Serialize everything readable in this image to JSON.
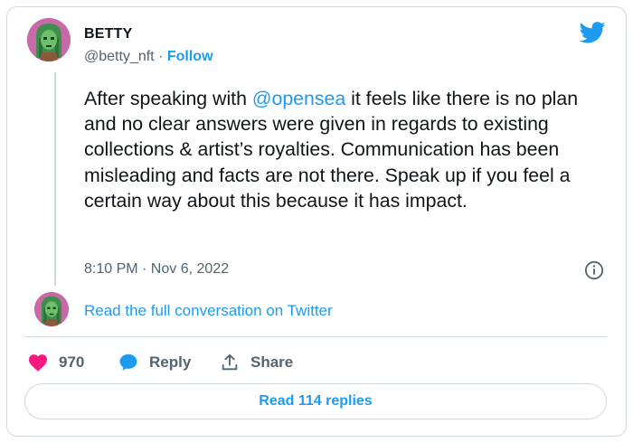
{
  "author": {
    "name": "BETTY",
    "handle": "@betty_nft",
    "separator": "·",
    "follow_label": "Follow"
  },
  "tweet": {
    "text_before": "After speaking with ",
    "mention": "@opensea",
    "text_after": " it feels like there is no plan and no clear answers were given in regards to existing collections & artist’s royalties. Communication has been misleading and facts are not there. Speak up if you feel a certain way about this because it has impact.",
    "timestamp": "8:10 PM · Nov 6, 2022"
  },
  "conversation_link": "Read the full conversation on Twitter",
  "actions": {
    "likes": "970",
    "reply_label": "Reply",
    "share_label": "Share"
  },
  "read_replies_label": "Read 114 replies",
  "colors": {
    "accent": "#1d9bf0",
    "like": "#f91880",
    "text": "#0f1419",
    "muted": "#536471",
    "border": "#cfd9de",
    "avatar_bg": "#c86aa8"
  },
  "icons": {
    "brand": "twitter-bird-icon",
    "info": "info-icon",
    "like": "heart-icon",
    "reply": "speech-bubble-icon",
    "share": "share-upload-icon"
  }
}
